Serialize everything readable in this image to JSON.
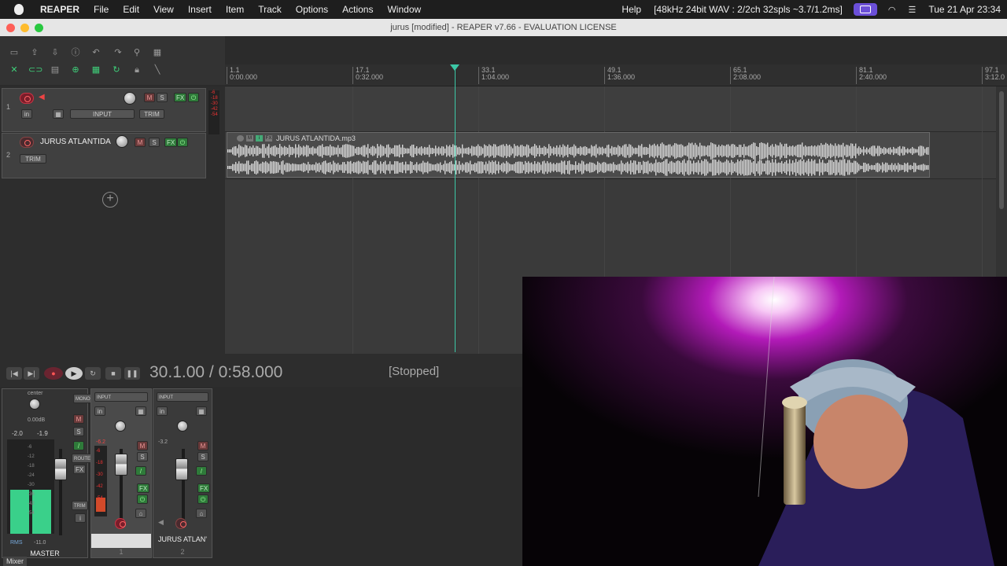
{
  "menubar": {
    "app": "REAPER",
    "items": [
      "File",
      "Edit",
      "View",
      "Insert",
      "Item",
      "Track",
      "Options",
      "Actions",
      "Window"
    ],
    "help": "Help",
    "audio_info": "[48kHz 24bit WAV : 2/2ch 32spls ~3.7/1.2ms]",
    "datetime": "Tue 21 Apr  23:34"
  },
  "window": {
    "title": "jurus [modified] - REAPER v7.66 - EVALUATION LICENSE"
  },
  "ruler": {
    "marks": [
      {
        "bar": "1.1",
        "time": "0:00.000"
      },
      {
        "bar": "17.1",
        "time": "0:32.000"
      },
      {
        "bar": "33.1",
        "time": "1:04.000"
      },
      {
        "bar": "49.1",
        "time": "1:36.000"
      },
      {
        "bar": "65.1",
        "time": "2:08.000"
      },
      {
        "bar": "81.1",
        "time": "2:40.000"
      },
      {
        "bar": "97.1",
        "time": "3:12.0"
      }
    ]
  },
  "tracks": [
    {
      "number": "1",
      "name": "",
      "input_label": "INPUT",
      "io": "in",
      "trim_label": "TRIM",
      "mute": "M",
      "solo": "S",
      "fx": "FX",
      "meter_labels": [
        "-6",
        "-18",
        "-30",
        "-42",
        "-54"
      ]
    },
    {
      "number": "2",
      "name": "JURUS ATLANTIDA",
      "trim_label": "TRIM",
      "mute": "M",
      "solo": "S",
      "fx": "FX"
    }
  ],
  "media_item": {
    "name": "JURUS ATLANTIDA.mp3",
    "buttons": [
      "M",
      "i",
      "FX"
    ]
  },
  "transport": {
    "timecode": "30.1.00 / 0:58.000",
    "status": "[Stopped]"
  },
  "mixer": {
    "tab_label": "Mixer",
    "master": {
      "name": "MASTER",
      "pan_label": "center",
      "volume_label": "0.00dB",
      "peak_left": "-2.0",
      "peak_right": "-1.9",
      "rms_label": "RMS",
      "rms_value": "-11.0",
      "buttons": [
        "MONO",
        "M",
        "S",
        "ROUTE",
        "FX",
        "TRIM"
      ],
      "scale": [
        "-6",
        "-12",
        "-18",
        "-24",
        "-30",
        "-36",
        "-42",
        "-54"
      ]
    },
    "strips": [
      {
        "name": "",
        "number": "1",
        "input_label": "INPUT",
        "io": "in",
        "buttons": [
          "M",
          "S",
          "FX"
        ],
        "peak": "-6.2",
        "scale": [
          "-6",
          "-18",
          "-30",
          "-42",
          "-54"
        ]
      },
      {
        "name": "JURUS ATLAN'",
        "number": "2",
        "input_label": "INPUT",
        "io": "in",
        "buttons": [
          "M",
          "S",
          "FX"
        ],
        "peak": "-3.2"
      }
    ]
  },
  "colors": {
    "accent": "#3cc8a6",
    "record": "#c03040",
    "fx_green": "#2f7a3a",
    "siri": "#6b4fd8"
  }
}
